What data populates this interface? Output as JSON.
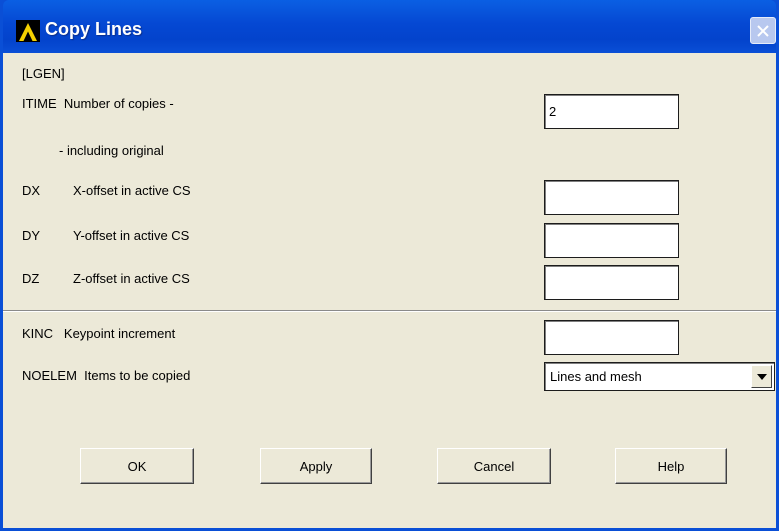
{
  "window": {
    "title": "Copy Lines",
    "icons": {
      "app": "ansys-logo-icon",
      "close": "close-icon"
    }
  },
  "form": {
    "command": "[LGEN]",
    "itime": {
      "label": "ITIME  Number of copies -",
      "sublabel": "- including original",
      "value": "2"
    },
    "dx": {
      "code": "DX",
      "label": "X-offset in active CS",
      "value": ""
    },
    "dy": {
      "code": "DY",
      "label": "Y-offset in active CS",
      "value": ""
    },
    "dz": {
      "code": "DZ",
      "label": "Z-offset in active CS",
      "value": ""
    },
    "kinc": {
      "label": "KINC   Keypoint increment",
      "value": ""
    },
    "noelem": {
      "label": "NOELEM  Items to be copied",
      "selected": "Lines and mesh"
    }
  },
  "buttons": {
    "ok": "OK",
    "apply": "Apply",
    "cancel": "Cancel",
    "help": "Help"
  },
  "colors": {
    "titlebar": "#0548d3",
    "client": "#ece9d8",
    "field": "#ffffff"
  }
}
